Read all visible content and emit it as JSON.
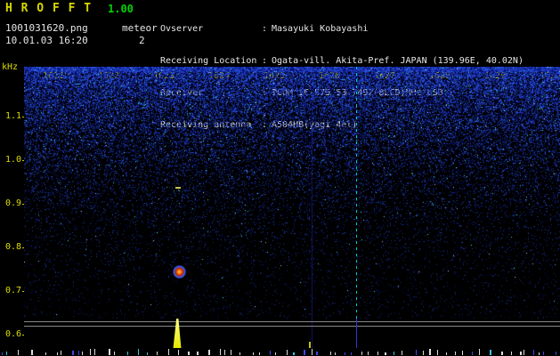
{
  "app": {
    "title": "H R O F F T",
    "version": "1.00",
    "filename": "1001031620.png",
    "mode": "meteor",
    "count": "2",
    "datetime": "10.01.03 16:20"
  },
  "info": {
    "separator": ":",
    "rows": [
      {
        "label": "Ovserver",
        "value": "Masayuki Kobayashi"
      },
      {
        "label": "Receiving Location",
        "value": "Ogata-vill. Akita-Pref. JAPAN (139.96E, 40.02N)"
      },
      {
        "label": "Receiver",
        "value": "ICOM IC-575 53.7492(8LCD)MHz USB"
      },
      {
        "label": "Receiving antenna",
        "value": "A504HB(yagi 4el)"
      }
    ]
  },
  "axes": {
    "unit": "kHz",
    "time_labels": [
      "1621",
      "1622",
      "1623",
      "1624",
      "1625",
      "1626",
      "1627",
      "1628",
      "1629",
      "1630"
    ],
    "freq_labels": [
      "1.1",
      "1.0",
      "0.9",
      "0.8",
      "0.7",
      "0.6"
    ]
  }
}
